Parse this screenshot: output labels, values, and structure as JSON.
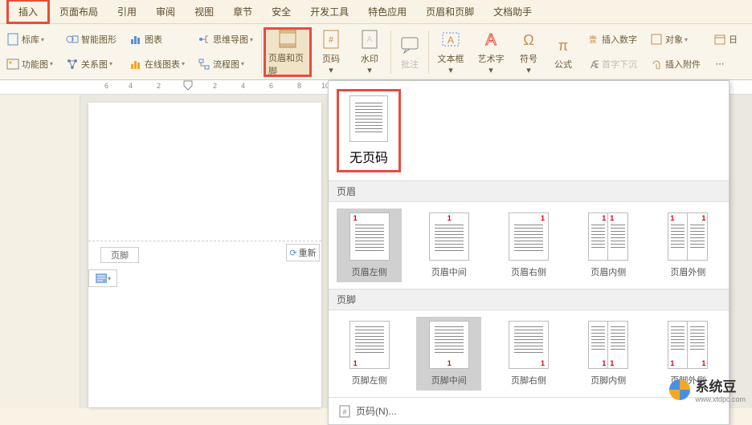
{
  "tabs": {
    "insert": "插入",
    "layout": "页面布局",
    "ref": "引用",
    "review": "审阅",
    "view": "视图",
    "chapter": "章节",
    "security": "安全",
    "dev": "开发工具",
    "special": "特色应用",
    "headerfooter": "页眉和页脚",
    "helper": "文档助手"
  },
  "ribbon": {
    "coverlib": "标库",
    "funcimg": "功能图",
    "smartshape": "智能图形",
    "chart": "图表",
    "relchart": "关系图",
    "onlinechart": "在线图表",
    "mindmap": "思维导图",
    "flowchart": "流程图",
    "hf": "页眉和页脚",
    "pagenum": "页码",
    "watermark": "水印",
    "comment": "批注",
    "textbox": "文本框",
    "wordart": "艺术字",
    "symbol": "符号",
    "formula": "公式",
    "insnum": "插入数字",
    "object": "对象",
    "firstcap": "首字下沉",
    "insattach": "插入附件",
    "date": "日"
  },
  "ruler": {
    "m6": "6",
    "m4": "4",
    "m2": "2",
    "p2": "2",
    "p4": "4",
    "p6": "6",
    "p8": "8",
    "p10": "10"
  },
  "doc": {
    "footer": "页脚",
    "update": "重新"
  },
  "dropdown": {
    "none": "无页码",
    "header_title": "页眉",
    "header_items": [
      "页眉左侧",
      "页眉中间",
      "页眉右侧",
      "页眉内侧",
      "页眉外侧"
    ],
    "footer_title": "页脚",
    "footer_items": [
      "页脚左侧",
      "页脚中间",
      "页脚右侧",
      "页脚内侧",
      "页脚外侧"
    ],
    "more": "页码(N)..."
  },
  "watermark": {
    "brand": "系统豆",
    "url": "www.xtdpc.com"
  }
}
